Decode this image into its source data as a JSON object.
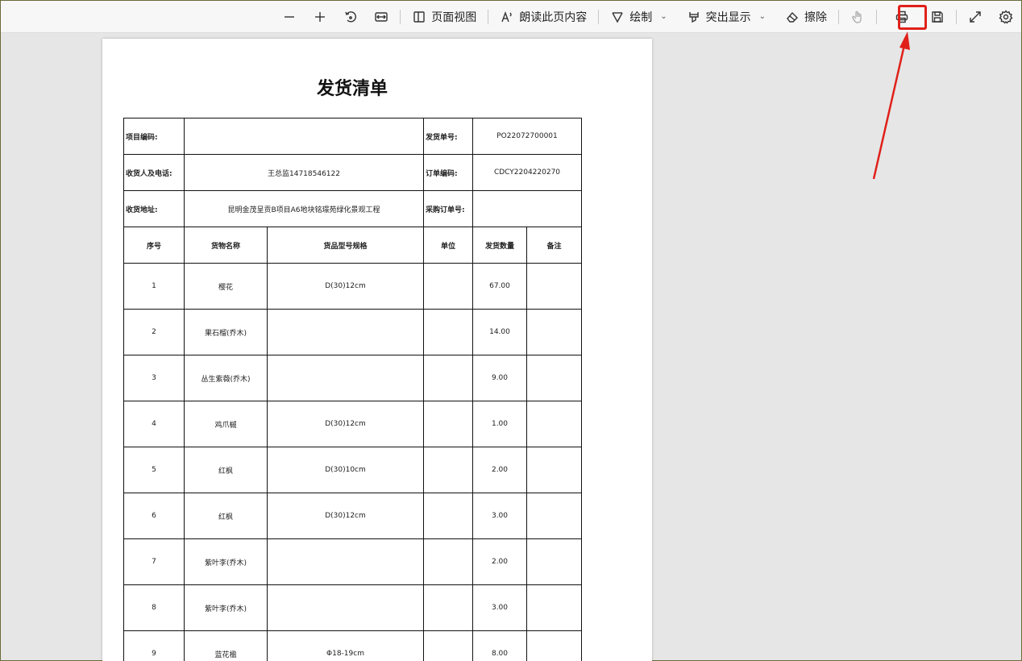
{
  "toolbar": {
    "page_view_label": "页面视图",
    "read_aloud_label": "朗读此页内容",
    "draw_label": "绘制",
    "highlight_label": "突出显示",
    "erase_label": "擦除"
  },
  "document": {
    "title": "发货清单",
    "fields": {
      "project_code_label": "项目编码:",
      "project_code_value": "",
      "shipment_no_label": "发货单号:",
      "shipment_no_value": "PO22072700001",
      "receiver_label": "收货人及电话:",
      "receiver_value": "王总监14718546122",
      "order_code_label": "订单编码:",
      "order_code_value": "CDCY2204220270",
      "address_label": "收货地址:",
      "address_value": "昆明金茂呈贡B项目A6地块铭璟苑绿化景观工程",
      "purchase_no_label": "采购订单号:",
      "purchase_no_value": ""
    },
    "columns": [
      "序号",
      "货物名称",
      "货品型号规格",
      "单位",
      "发货数量",
      "备注"
    ],
    "rows": [
      {
        "no": "1",
        "name": "樱花",
        "spec": "D(30)12cm",
        "unit": "",
        "qty": "67.00",
        "note": ""
      },
      {
        "no": "2",
        "name": "果石榴(乔木)",
        "spec": "",
        "unit": "",
        "qty": "14.00",
        "note": ""
      },
      {
        "no": "3",
        "name": "丛生紫薇(乔木)",
        "spec": "",
        "unit": "",
        "qty": "9.00",
        "note": ""
      },
      {
        "no": "4",
        "name": "鸡爪槭",
        "spec": "D(30)12cm",
        "unit": "",
        "qty": "1.00",
        "note": ""
      },
      {
        "no": "5",
        "name": "红枫",
        "spec": "D(30)10cm",
        "unit": "",
        "qty": "2.00",
        "note": ""
      },
      {
        "no": "6",
        "name": "红枫",
        "spec": "D(30)12cm",
        "unit": "",
        "qty": "3.00",
        "note": ""
      },
      {
        "no": "7",
        "name": "紫叶李(乔木)",
        "spec": "",
        "unit": "",
        "qty": "2.00",
        "note": ""
      },
      {
        "no": "8",
        "name": "紫叶李(乔木)",
        "spec": "",
        "unit": "",
        "qty": "3.00",
        "note": ""
      },
      {
        "no": "9",
        "name": "蓝花楹",
        "spec": "Φ18-19cm",
        "unit": "",
        "qty": "8.00",
        "note": ""
      }
    ]
  },
  "colors": {
    "annotation": "#e0201a",
    "page": "#ffffff",
    "canvas": "#e6e6e6"
  }
}
